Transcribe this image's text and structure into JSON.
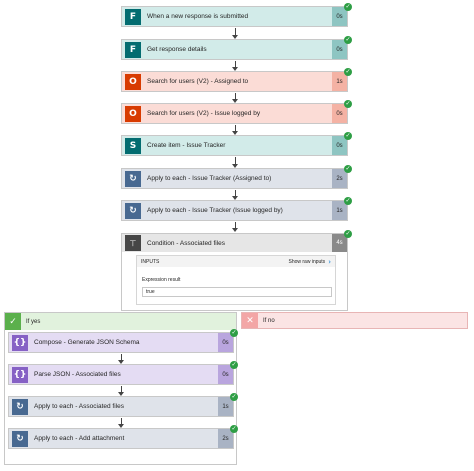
{
  "colors": {
    "success": "#2e9e45",
    "teal": "#036c70",
    "office": "#d83b01",
    "loop": "#486991",
    "condition": "#484644",
    "data_op": "#8661c5"
  },
  "main_steps": [
    {
      "name": "forms-trigger",
      "label": "When a new response is submitted",
      "duration": "0s",
      "icon": "forms-icon"
    },
    {
      "name": "get-response",
      "label": "Get response details",
      "duration": "0s",
      "icon": "forms-icon"
    },
    {
      "name": "search-users-assigned",
      "label": "Search for users (V2) - Assigned to",
      "duration": "1s",
      "icon": "office365-icon"
    },
    {
      "name": "search-users-logged",
      "label": "Search for users (V2) - Issue logged by",
      "duration": "0s",
      "icon": "office365-icon"
    },
    {
      "name": "create-item",
      "label": "Create item - Issue Tracker",
      "duration": "0s",
      "icon": "sharepoint-icon"
    },
    {
      "name": "apply-assigned",
      "label": "Apply to each - Issue Tracker (Assigned to)",
      "duration": "2s",
      "icon": "loop-icon"
    },
    {
      "name": "apply-logged",
      "label": "Apply to each - Issue Tracker (Issue logged by)",
      "duration": "1s",
      "icon": "loop-icon"
    }
  ],
  "condition": {
    "label": "Condition - Associated files",
    "duration": "4s",
    "inputs_title": "INPUTS",
    "show_raw": "Show raw inputs",
    "expr_label": "Expression result",
    "expr_value": "true"
  },
  "branch_yes": {
    "label": "If yes",
    "steps": [
      {
        "label": "Compose - Generate JSON Schema",
        "duration": "0s",
        "icon": "data-operation-icon"
      },
      {
        "label": "Parse JSON - Associated files",
        "duration": "0s",
        "icon": "data-operation-icon"
      },
      {
        "label": "Apply to each - Associated files",
        "duration": "1s",
        "icon": "loop-icon"
      },
      {
        "label": "Apply to each - Add attachment",
        "duration": "2s",
        "icon": "loop-icon"
      }
    ]
  },
  "branch_no": {
    "label": "If no"
  }
}
